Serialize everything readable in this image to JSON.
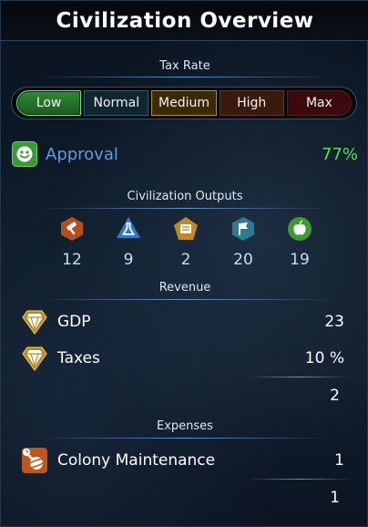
{
  "title": "Civilization Overview",
  "tax": {
    "label": "Tax Rate",
    "options": [
      "Low",
      "Normal",
      "Medium",
      "High",
      "Max"
    ],
    "selected": "Low"
  },
  "approval": {
    "label": "Approval",
    "value": "77%"
  },
  "outputs": {
    "label": "Civilization Outputs",
    "items": [
      {
        "icon": "industry-hammer-icon",
        "value": "12",
        "color": "#b5501c"
      },
      {
        "icon": "science-flask-icon",
        "value": "9",
        "color": "#2f7ad0"
      },
      {
        "icon": "influence-scroll-icon",
        "value": "2",
        "color": "#c48a22"
      },
      {
        "icon": "dust-flag-icon",
        "value": "20",
        "color": "#2e7a92"
      },
      {
        "icon": "food-apple-icon",
        "value": "19",
        "color": "#3d9a35"
      }
    ]
  },
  "revenue": {
    "label": "Revenue",
    "rows": [
      {
        "icon": "gdp-gem-icon",
        "label": "GDP",
        "value": "23"
      },
      {
        "icon": "taxes-gem-icon",
        "label": "Taxes",
        "value": "10 %"
      }
    ],
    "total": "2"
  },
  "expenses": {
    "label": "Expenses",
    "rows": [
      {
        "icon": "maintenance-wrench-planet-icon",
        "label": "Colony Maintenance",
        "value": "1"
      }
    ],
    "total": "1"
  },
  "colors": {
    "approval_label": "#5f9be0",
    "approval_value": "#52e24a",
    "output_values": "#bfe0f2",
    "divider": "#6eaae6"
  }
}
